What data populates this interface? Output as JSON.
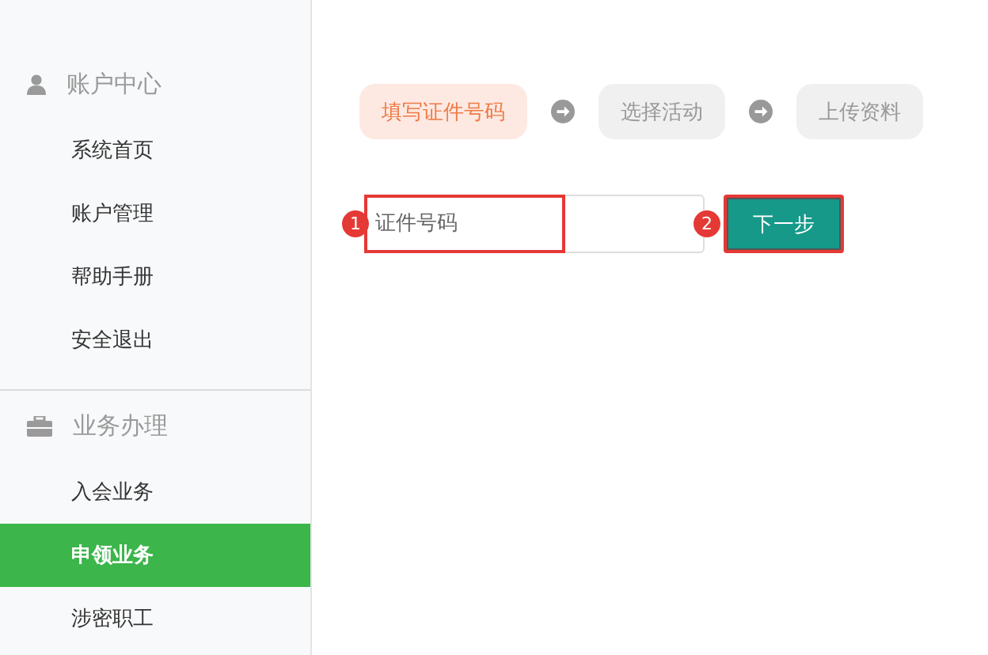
{
  "sidebar": {
    "groups": [
      {
        "title": "账户中心",
        "kind": "user",
        "items": [
          {
            "label": "系统首页",
            "selected": false
          },
          {
            "label": "账户管理",
            "selected": false
          },
          {
            "label": "帮助手册",
            "selected": false
          },
          {
            "label": "安全退出",
            "selected": false
          }
        ]
      },
      {
        "title": "业务办理",
        "kind": "briefcase",
        "items": [
          {
            "label": "入会业务",
            "selected": false
          },
          {
            "label": "申领业务",
            "selected": true
          },
          {
            "label": "涉密职工",
            "selected": false
          }
        ]
      }
    ]
  },
  "steps": [
    {
      "label": "填写证件号码",
      "selected": true
    },
    {
      "label": "选择活动",
      "selected": false
    },
    {
      "label": "上传资料",
      "selected": false
    }
  ],
  "form": {
    "id_field": {
      "placeholder": "证件号码"
    },
    "next_button": "下一步"
  },
  "annotations": [
    {
      "number": "1"
    },
    {
      "number": "2"
    }
  ]
}
